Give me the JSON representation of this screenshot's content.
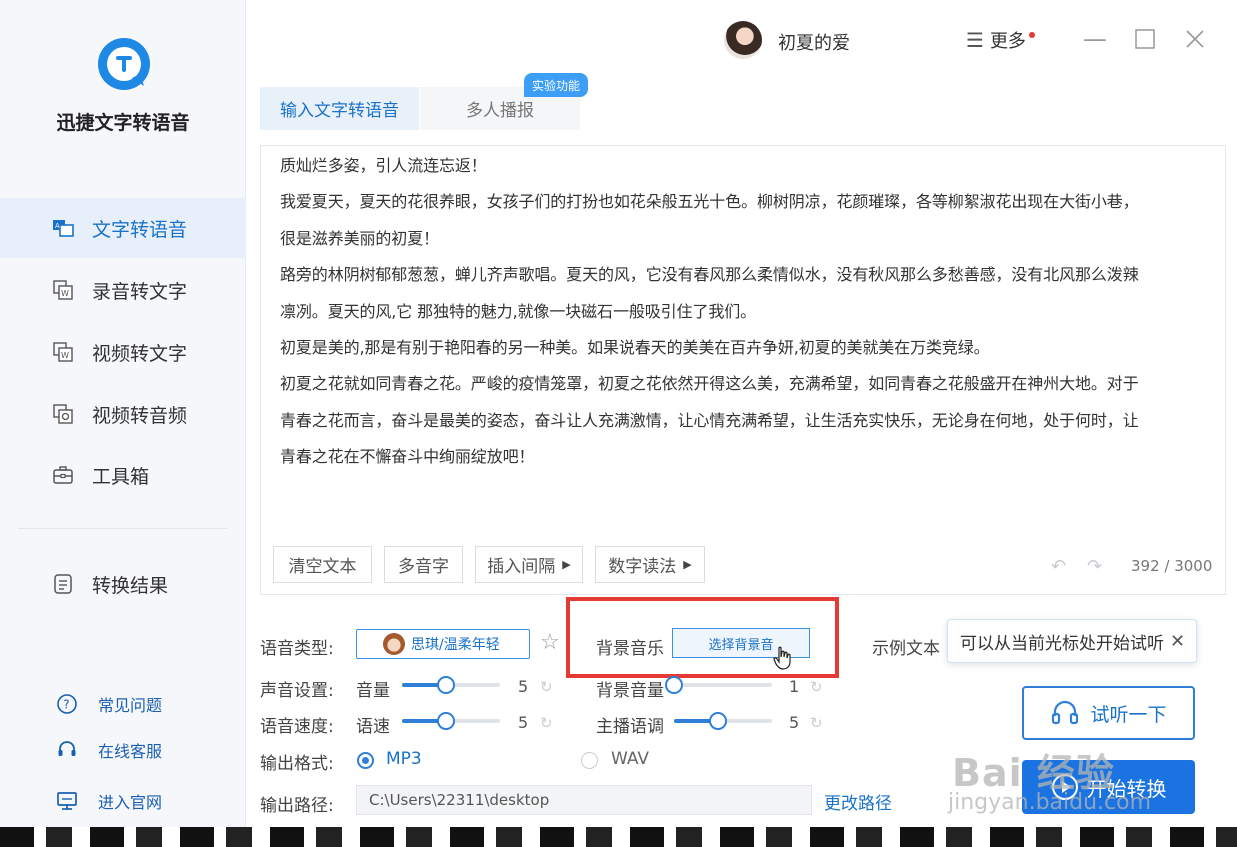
{
  "app": {
    "name": "迅捷文字转语音",
    "user": "初夏的爱",
    "more_label": "更多"
  },
  "sidebar": {
    "items": [
      {
        "label": "文字转语音",
        "icon": "text-to-speech-icon",
        "active": true
      },
      {
        "label": "录音转文字",
        "icon": "audio-to-text-icon"
      },
      {
        "label": "视频转文字",
        "icon": "video-to-text-icon"
      },
      {
        "label": "视频转音频",
        "icon": "video-to-audio-icon"
      },
      {
        "label": "工具箱",
        "icon": "toolbox-icon"
      },
      {
        "label": "转换结果",
        "icon": "results-icon"
      }
    ],
    "footer": [
      {
        "label": "常见问题",
        "icon": "question-icon"
      },
      {
        "label": "在线客服",
        "icon": "headset-icon"
      },
      {
        "label": "进入官网",
        "icon": "monitor-icon"
      }
    ]
  },
  "tabs": [
    {
      "label": "输入文字转语音",
      "active": true
    },
    {
      "label": "多人播报",
      "badge": "实验功能"
    }
  ],
  "editor": {
    "content": "质灿烂多姿，引人流连忘返！\n我爱夏天，夏天的花很养眼，女孩子们的打扮也如花朵般五光十色。柳树阴凉，花颜璀璨，各等柳絮淑花出现在大街小巷，\n很是滋养美丽的初夏！\n路旁的林阴树郁郁葱葱，蝉儿齐声歌唱。夏天的风，它没有春风那么柔情似水，没有秋风那么多愁善感，没有北风那么泼辣\n凛冽。夏天的风,它 那独特的魅力,就像一块磁石一般吸引住了我们。\n初夏是美的,那是有别于艳阳春的另一种美。如果说春天的美美在百卉争妍,初夏的美就美在万类竞绿。\n初夏之花就如同青春之花。严峻的疫情笼罩，初夏之花依然开得这么美，充满希望，如同青春之花般盛开在神州大地。对于\n青春之花而言，奋斗是最美的姿态，奋斗让人充满激情，让心情充满希望，让生活充实快乐，无论身在何地，处于何时，让\n青春之花在不懈奋斗中绚丽绽放吧！",
    "tools": {
      "clear": "清空文本",
      "polyphone": "多音字",
      "insert_pause": "插入间隔",
      "number_reading": "数字读法"
    },
    "counter": "392 / 3000"
  },
  "settings": {
    "voice_type_label": "语音类型:",
    "voice_name": "思琪/温柔年轻",
    "bgm_label": "背景音乐",
    "bgm_button": "选择背景音",
    "sample_text_label": "示例文本",
    "tooltip": "可以从当前光标处开始试听",
    "sound_label": "声音设置:",
    "volume_label": "音量",
    "volume_value": "5",
    "volume_fraction": 0.45,
    "bg_volume_label": "背景音量",
    "bg_volume_value": "1",
    "bg_volume_fraction": 0.0,
    "speed_label": "语音速度:",
    "speed_sub_label": "语速",
    "speed_value": "5",
    "speed_fraction": 0.45,
    "pitch_label": "主播语调",
    "pitch_value": "5",
    "pitch_fraction": 0.45,
    "format_label": "输出格式:",
    "format_mp3": "MP3",
    "format_wav": "WAV",
    "path_label": "输出路径:",
    "path_value": "C:\\Users\\22311\\desktop",
    "change_path": "更改路径"
  },
  "actions": {
    "listen": "试听一下",
    "convert": "开始转换"
  },
  "watermark": {
    "big": "Bai 经验",
    "small": "jingyan.baidu.com"
  },
  "colors": {
    "accent": "#1a73c9",
    "highlight_box": "#e53935"
  }
}
